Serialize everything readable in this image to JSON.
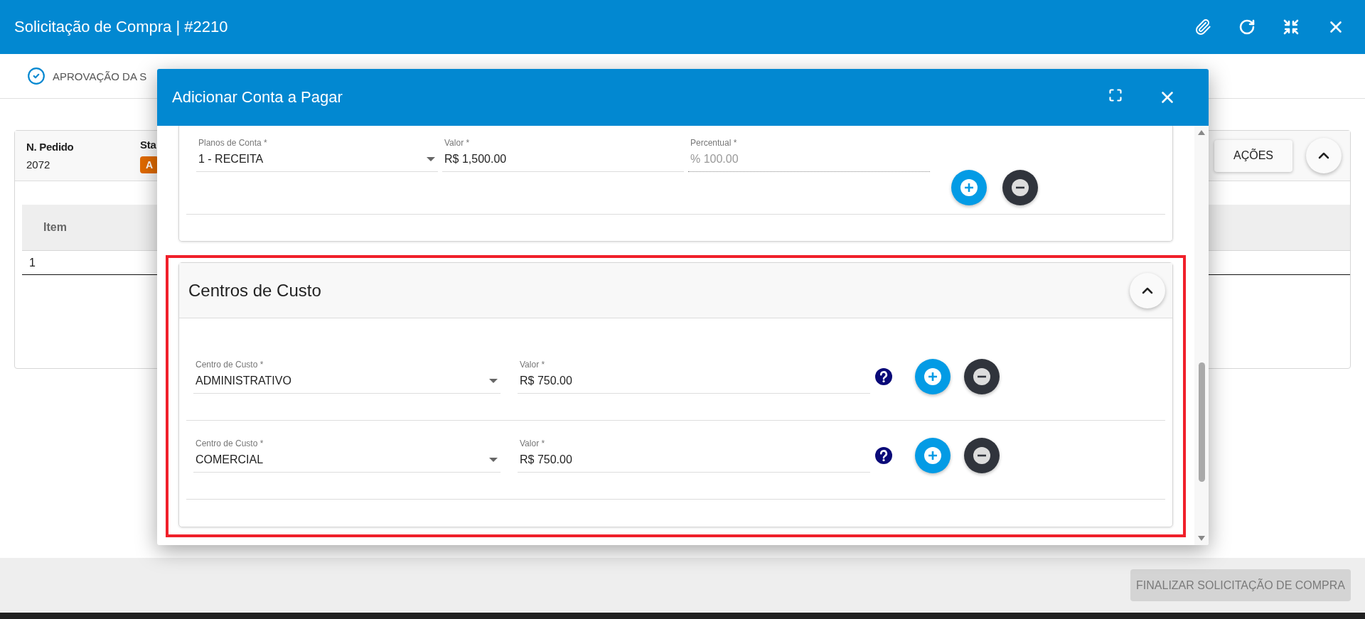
{
  "window": {
    "title": "Solicitação de Compra | #2210"
  },
  "stepper": [
    {
      "label": "APROVAÇÃO DA S",
      "done": true
    }
  ],
  "order_card": {
    "fields": [
      {
        "label": "N. Pedido",
        "value": "2072"
      },
      {
        "label": "Sta",
        "badge": "A"
      }
    ],
    "actions_button": "AÇÕES",
    "expanded": true,
    "table": {
      "columns": [
        "Item"
      ],
      "rows": [
        [
          "1"
        ]
      ]
    }
  },
  "footer": {
    "button": "FINALIZAR SOLICITAÇÃO DE COMPRA",
    "disabled": true
  },
  "dialog": {
    "title": "Adicionar Conta a Pagar",
    "account_plans": [
      {
        "plan_label": "Planos de Conta *",
        "plan": "1 - RECEITA",
        "value_label": "Valor *",
        "value": "R$ 1,500.00",
        "percent_label": "Percentual *",
        "percent": "% 100.00",
        "percent_disabled": true
      }
    ],
    "cost_centers": {
      "title": "Centros de Custo",
      "expanded": true,
      "highlighted": true,
      "rows": [
        {
          "center_label": "Centro de Custo *",
          "center": "ADMINISTRATIVO",
          "value_label": "Valor *",
          "value": "R$ 750.00"
        },
        {
          "center_label": "Centro de Custo *",
          "center": "COMERCIAL",
          "value_label": "Valor *",
          "value": "R$ 750.00"
        }
      ]
    }
  }
}
